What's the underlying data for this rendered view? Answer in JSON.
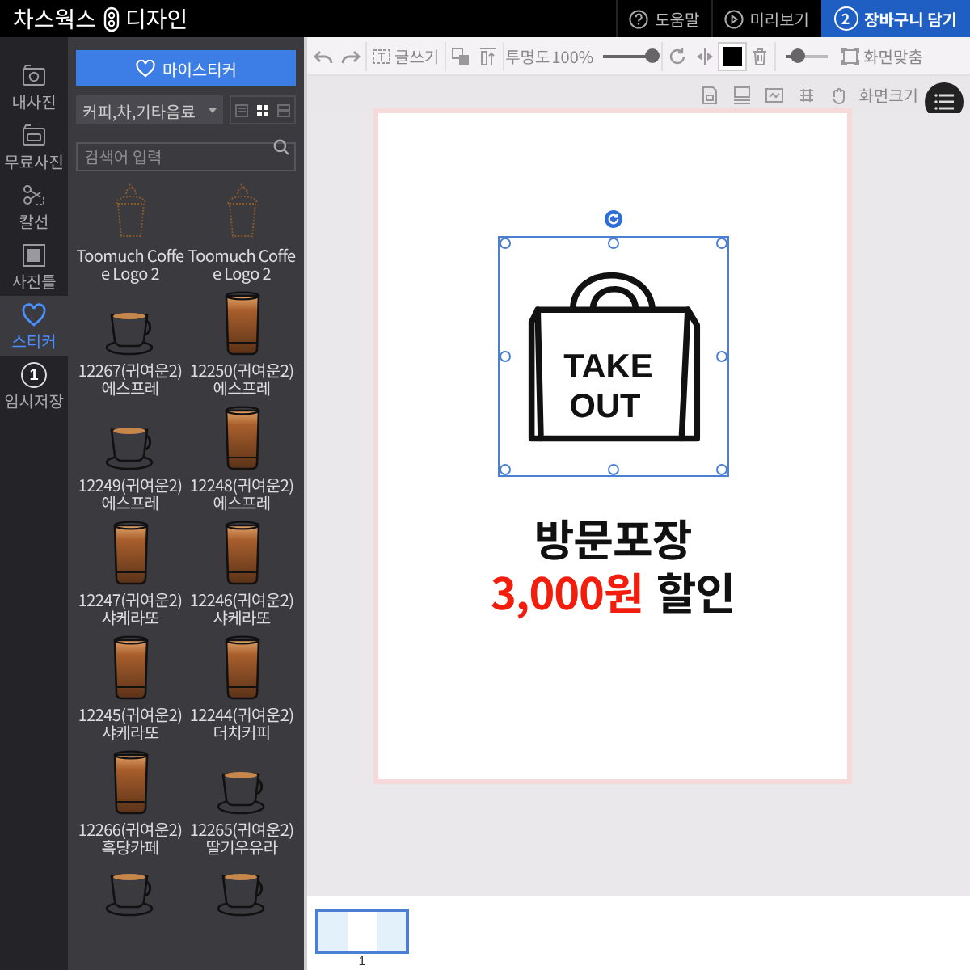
{
  "header": {
    "logo": "차스웍스",
    "subtitle": "디자인",
    "links": [
      {
        "kind": "help",
        "label": "도움말"
      },
      {
        "kind": "preview",
        "label": "미리보기"
      }
    ],
    "cart_button": {
      "badge": "2",
      "label": "장바구니 담기"
    }
  },
  "rail": [
    {
      "kind": "photo",
      "label": "내사진",
      "selected": false
    },
    {
      "kind": "free",
      "label": "무료사진",
      "selected": false
    },
    {
      "kind": "cut",
      "label": "칼선",
      "selected": false
    },
    {
      "kind": "frame",
      "label": "사진틀",
      "selected": false
    },
    {
      "kind": "sticker",
      "label": "스티커",
      "selected": true
    },
    {
      "kind": "save",
      "label": "임시저장",
      "badge": "1",
      "selected": false
    }
  ],
  "sticker_panel": {
    "my_button": "마이스티커",
    "category": "커피,차,기타음료",
    "views": [
      {
        "kind": "list",
        "selected": false
      },
      {
        "kind": "grid",
        "selected": true
      },
      {
        "kind": "rows",
        "selected": false
      }
    ],
    "search": {
      "placeholder": "검색어 입력"
    },
    "stickers": [
      {
        "kind": "logo",
        "label": "Toomuch Coffee Logo 2"
      },
      {
        "kind": "logo",
        "label": "Toomuch Coffee Logo 2"
      },
      {
        "kind": "cup",
        "label": "12267(귀여운2)에스프레"
      },
      {
        "kind": "glass",
        "label": "12250(귀여운2)에스프레"
      },
      {
        "kind": "cup",
        "label": "12249(귀여운2)에스프레"
      },
      {
        "kind": "glass",
        "label": "12248(귀여운2)에스프레"
      },
      {
        "kind": "glass",
        "label": "12247(귀여운2)샤케라또"
      },
      {
        "kind": "glass",
        "label": "12246(귀여운2)샤케라또"
      },
      {
        "kind": "glass",
        "label": "12245(귀여운2)샤케라또"
      },
      {
        "kind": "glass",
        "label": "12244(귀여운2)더치커피"
      },
      {
        "kind": "glass",
        "label": "12266(귀여운2)흑당카페"
      },
      {
        "kind": "cup",
        "label": "12265(귀여운2)딸기우유라"
      },
      {
        "kind": "cup"
      },
      {
        "kind": "cup"
      }
    ]
  },
  "toolbar": {
    "write": "글쓰기",
    "opacity_label": "투명도",
    "opacity_value": "100%",
    "opacity": {
      "level": 1
    },
    "zoom": {
      "level": 0.3
    },
    "fit": "화면맞춤",
    "screen_size": "화면크기"
  },
  "canvas": {
    "selected": true,
    "bag_text": [
      "TAKE",
      "OUT"
    ],
    "headline": "방문포장",
    "discount": [
      {
        "text": "3,000원",
        "accent": true
      },
      {
        "text": "할인",
        "accent": false
      }
    ]
  },
  "pages": [
    {
      "label": "1",
      "selected": true
    }
  ]
}
